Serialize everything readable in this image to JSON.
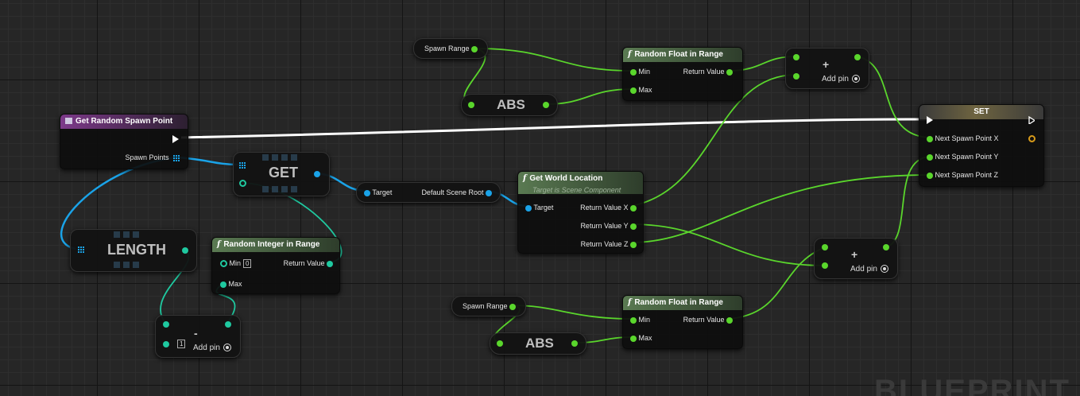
{
  "nodes": {
    "get_random_spawn_point": {
      "title": "Get Random Spawn Point",
      "pin_spawn_points": "Spawn Points"
    },
    "get": {
      "label": "GET"
    },
    "length": {
      "label": "LENGTH"
    },
    "random_integer": {
      "title": "Random Integer in Range",
      "pin_min": "Min",
      "min_value": "0",
      "pin_max": "Max",
      "pin_return": "Return Value"
    },
    "subtract": {
      "symbol": "-",
      "value": "1",
      "add_pin": "Add pin"
    },
    "scene_root": {
      "pin_target": "Target",
      "pin_out": "Default Scene Root"
    },
    "get_world_location": {
      "title": "Get World Location",
      "subtitle": "Target is Scene Component",
      "pin_target": "Target",
      "pin_x": "Return Value X",
      "pin_y": "Return Value Y",
      "pin_z": "Return Value Z"
    },
    "spawn_range_top": {
      "label": "Spawn Range"
    },
    "abs_top": {
      "label": "ABS"
    },
    "random_float_top": {
      "title": "Random Float in Range",
      "pin_min": "Min",
      "pin_max": "Max",
      "pin_return": "Return Value"
    },
    "add_top": {
      "symbol": "+",
      "add_pin": "Add pin"
    },
    "set": {
      "title": "SET",
      "pin_x": "Next Spawn Point X",
      "pin_y": "Next Spawn Point Y",
      "pin_z": "Next Spawn Point Z"
    },
    "add_bottom": {
      "symbol": "+",
      "add_pin": "Add pin"
    },
    "spawn_range_bottom": {
      "label": "Spawn Range"
    },
    "abs_bottom": {
      "label": "ABS"
    },
    "random_float_bottom": {
      "title": "Random Float in Range",
      "pin_min": "Min",
      "pin_max": "Max",
      "pin_return": "Return Value"
    }
  },
  "watermark": "BLUEPRINT",
  "colors": {
    "float_pin": "#5ad62c",
    "object_pin": "#1aa3e8",
    "int_pin": "#1fc9a0",
    "exec": "#ffffff",
    "function_header": "#5a7a52",
    "event_header": "#7d3a8a"
  }
}
